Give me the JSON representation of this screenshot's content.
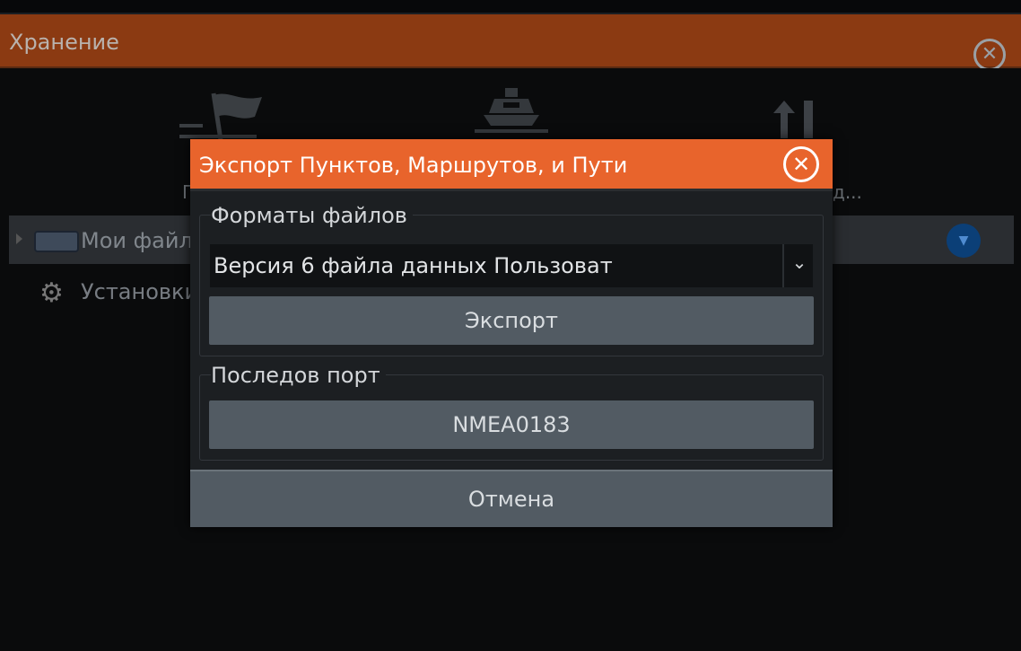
{
  "outer_window": {
    "title": "Хранение",
    "close_icon": "close-icon"
  },
  "toolbar_partial_labels": {
    "left": "П",
    "right": "д..."
  },
  "tree": {
    "my_files_label": "Мои файл",
    "settings_label": "Установки"
  },
  "dialog": {
    "title": "Экспорт Пунктов, Маршрутов, и Пути",
    "file_formats": {
      "label": "Форматы файлов",
      "selected_value": "Версия 6 файла данных Пользоват",
      "export_button": "Экспорт"
    },
    "serial_port": {
      "label": "Последов порт",
      "button": "NMEA0183"
    },
    "cancel_button": "Отмена"
  },
  "colors": {
    "dialog_header": "#e8642c",
    "outer_header": "#8b3a12",
    "button": "#525b63",
    "accent_blue": "#0b3f77"
  }
}
